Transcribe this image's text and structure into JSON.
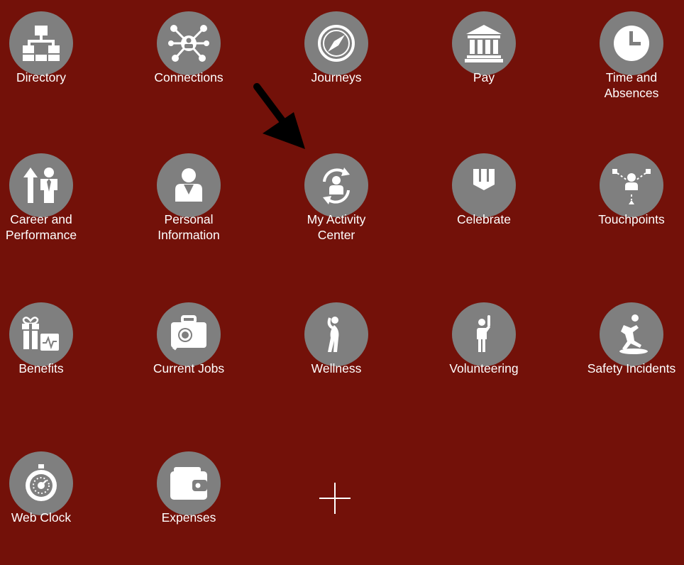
{
  "tiles": [
    {
      "label": "Directory",
      "icon": "directory-icon"
    },
    {
      "label": "Connections",
      "icon": "connections-icon"
    },
    {
      "label": "Journeys",
      "icon": "compass-icon"
    },
    {
      "label": "Pay",
      "icon": "bank-icon"
    },
    {
      "label": "Time and\nAbsences",
      "icon": "clock-icon"
    },
    {
      "label": "Career and\nPerformance",
      "icon": "career-icon"
    },
    {
      "label": "Personal\nInformation",
      "icon": "person-icon"
    },
    {
      "label": "My Activity\nCenter",
      "icon": "activity-center-icon"
    },
    {
      "label": "Celebrate",
      "icon": "celebrate-icon"
    },
    {
      "label": "Touchpoints",
      "icon": "touchpoints-icon"
    },
    {
      "label": "Benefits",
      "icon": "benefits-icon"
    },
    {
      "label": "Current Jobs",
      "icon": "briefcase-search-icon"
    },
    {
      "label": "Wellness",
      "icon": "stretching-person-icon"
    },
    {
      "label": "Volunteering",
      "icon": "raised-hand-person-icon"
    },
    {
      "label": "Safety Incidents",
      "icon": "slip-fall-icon"
    },
    {
      "label": "Web Clock",
      "icon": "stopwatch-icon"
    },
    {
      "label": "Expenses",
      "icon": "wallet-icon"
    }
  ],
  "colors": {
    "background": "#731109",
    "circle": "#7f7f7f",
    "text": "#ffffff"
  }
}
